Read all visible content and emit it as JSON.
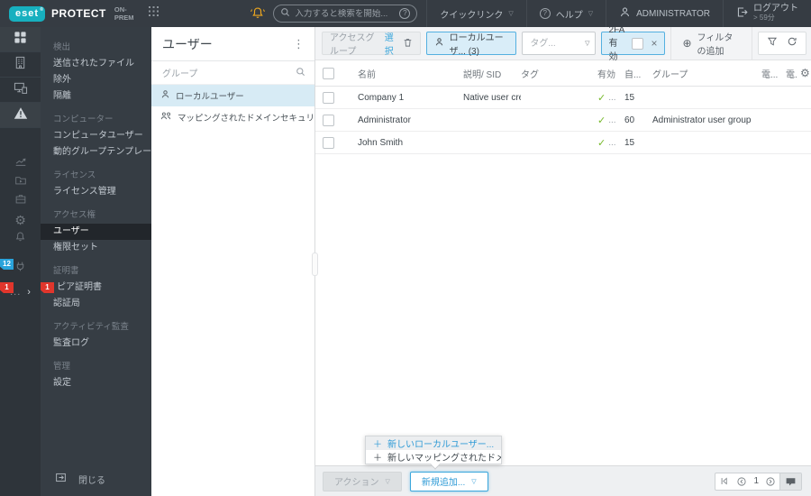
{
  "colors": {
    "brand_teal": "#17b0bf",
    "accent_blue": "#2f9bd6",
    "check_green": "#76b82a",
    "badge_blue": "#2aa3db",
    "badge_red": "#e0362c",
    "bell_orange": "#eda71f",
    "topbar_bg": "#363c43",
    "rail_bg": "#2e343a",
    "menu_bg": "#363d44",
    "selected_row_blue": "#d7ebf5"
  },
  "topbar": {
    "logo_text": "eset",
    "logo_reg": "®",
    "product": "PROTECT",
    "edition": "ON-PREM",
    "search_placeholder": "入力すると検索を開始...",
    "quick_links": "クイックリンク",
    "help_label": "ヘルプ",
    "help_q": "?",
    "search_q": "?",
    "user": "ADMINISTRATOR",
    "logout_label": "ログアウト",
    "logout_timer": "> 59分"
  },
  "rail": {
    "badge_status": "12",
    "badge_more": "1",
    "more_dots": "...",
    "chevron": "›"
  },
  "sidebar": {
    "rows": [
      {
        "label": "検出"
      },
      {
        "label": "送信されたファイル"
      },
      {
        "label": "除外"
      },
      {
        "label": "隔離"
      },
      {
        "label": "コンピューター"
      },
      {
        "label": "コンピュータユーザー"
      },
      {
        "label": "動的グループテンプレート"
      },
      {
        "label": "ライセンス"
      },
      {
        "label": "ライセンス管理"
      },
      {
        "label": "アクセス権"
      },
      {
        "label": "ユーザー"
      },
      {
        "label": "権限セット"
      },
      {
        "label": "証明書"
      },
      {
        "label": "ピア証明書",
        "badge": "1"
      },
      {
        "label": "認証局"
      },
      {
        "label": "アクティビティ監査"
      },
      {
        "label": "監査ログ"
      },
      {
        "label": "管理"
      },
      {
        "label": "設定"
      }
    ],
    "close_label": "閉じる"
  },
  "groups": {
    "title": "ユーザー",
    "menu_dots": "⋮",
    "search_label": "グループ",
    "items": [
      {
        "label": "ローカルユーザー",
        "selected": true
      },
      {
        "label": "マッピングされたドメインセキュリティグル...",
        "selected": false
      }
    ]
  },
  "toolbar": {
    "access_group_label": "アクセスグループ",
    "access_group_action": "選択",
    "local_user_chip": "ローカルユーザ... (3)",
    "tag_placeholder": "タグ...",
    "tfa_label": "2FA有効",
    "tfa_close": "×",
    "add_filter": "フィルタの追加",
    "add_filter_plus": "⊕"
  },
  "table": {
    "columns": [
      "名前",
      "説明/ SID",
      "タグ",
      "有効",
      "自...",
      "グループ",
      "電...",
      "電."
    ],
    "gear": "⚙",
    "rows": [
      {
        "name": "Company 1",
        "desc": "Native user cre...",
        "tag": "",
        "enabled_check": "✓",
        "enabled_more": "...",
        "auto": "15",
        "group": ""
      },
      {
        "name": "Administrator",
        "desc": "",
        "tag": "",
        "enabled_check": "✓",
        "enabled_more": "...",
        "auto": "60",
        "group": "Administrator user group"
      },
      {
        "name": "John Smith",
        "desc": "",
        "tag": "",
        "enabled_check": "✓",
        "enabled_more": "...",
        "auto": "15",
        "group": ""
      }
    ]
  },
  "popup": {
    "items": [
      {
        "plus": "＋",
        "label": "新しいローカルユーザー...",
        "highlighted": true
      },
      {
        "plus": "＋",
        "label": "新しいマッピングされたドメイ...",
        "highlighted": false
      }
    ]
  },
  "footer": {
    "actions_label": "アクション",
    "add_new_label": "新規追加...",
    "page": "1",
    "caret": "▽"
  }
}
